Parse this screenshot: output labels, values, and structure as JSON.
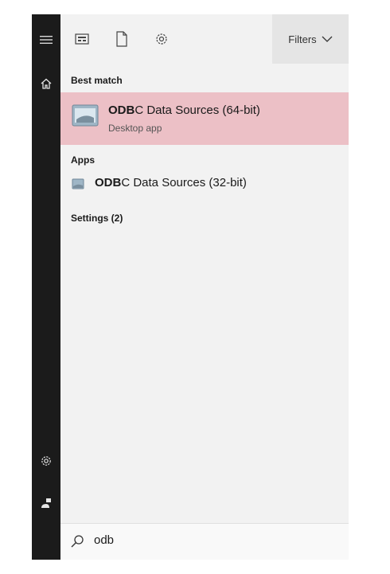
{
  "toolbar": {
    "filters_label": "Filters",
    "icons": [
      "card-icon",
      "document-icon",
      "settings-icon"
    ]
  },
  "left_rail": {
    "icons": [
      "hamburger-icon",
      "home-icon",
      "settings-icon",
      "user-icon"
    ]
  },
  "results": {
    "best_match_header": "Best match",
    "best_match": {
      "title_bold": "ODB",
      "title_rest": "C Data Sources (64-bit)",
      "subtitle": "Desktop app",
      "highlight_color": "#ecc0c6"
    },
    "apps_header": "Apps",
    "apps": [
      {
        "title_bold": "ODB",
        "title_rest": "C Data Sources (32-bit)"
      }
    ],
    "settings_header": "Settings (2)"
  },
  "search": {
    "query": "odb"
  }
}
